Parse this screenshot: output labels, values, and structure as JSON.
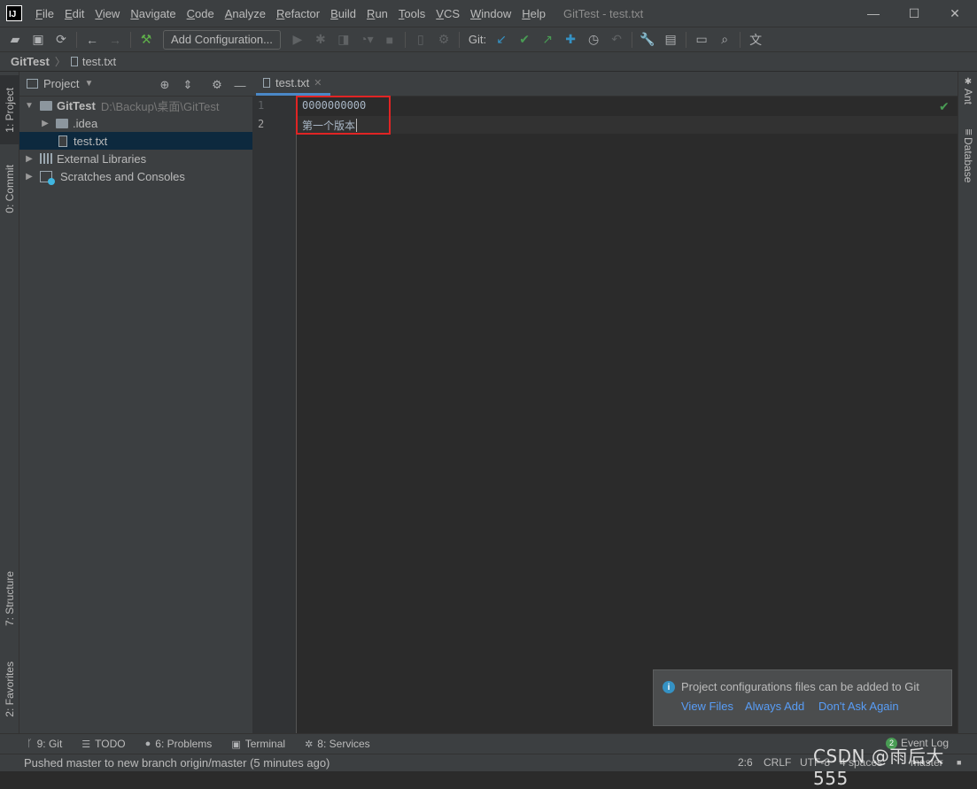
{
  "window": {
    "title": "GitTest - test.txt",
    "logo_text": "IJ",
    "controls": [
      "—",
      "☐",
      "✕"
    ]
  },
  "menu": [
    "File",
    "Edit",
    "View",
    "Navigate",
    "Code",
    "Analyze",
    "Refactor",
    "Build",
    "Run",
    "Tools",
    "VCS",
    "Window",
    "Help"
  ],
  "toolbar": {
    "add_configuration": "Add Configuration...",
    "git_label": "Git:"
  },
  "breadcrumb": {
    "project": "GitTest",
    "file": "test.txt"
  },
  "left_stripe": {
    "project_tab": "1: Project",
    "commit_tab": "0: Commit",
    "structure_tab": "7: Structure",
    "favorites_tab": "2: Favorites"
  },
  "right_stripe": {
    "ant_tab": "Ant",
    "database_tab": "Database"
  },
  "project_panel": {
    "title": "Project",
    "tree": {
      "root_name": "GitTest",
      "root_path": "D:\\Backup\\桌面\\GitTest",
      "idea": ".idea",
      "file": "test.txt",
      "external_libraries": "External Libraries",
      "scratches": "Scratches and Consoles"
    }
  },
  "editor": {
    "tab_label": "test.txt",
    "line_numbers": [
      "1",
      "2"
    ],
    "lines": [
      "0000000000",
      "第一个版本"
    ]
  },
  "notification": {
    "message": "Project configurations files can be added to Git",
    "actions": [
      "View Files",
      "Always Add",
      "Don't Ask Again"
    ]
  },
  "bottom_tools": {
    "git": "9: Git",
    "todo": "TODO",
    "problems": "6: Problems",
    "terminal": "Terminal",
    "services": "8: Services",
    "event_log": "Event Log",
    "event_count": "2"
  },
  "status": {
    "message": "Pushed master to new branch origin/master (5 minutes ago)",
    "position": "2:6",
    "line_sep": "CRLF",
    "encoding": "UTF-8",
    "indent": "4 spaces",
    "branch": "master"
  },
  "watermark": "CSDN @雨后大555",
  "colors": {
    "selection": "#0d293e",
    "highlight_box": "#e02424",
    "link": "#589df6"
  }
}
